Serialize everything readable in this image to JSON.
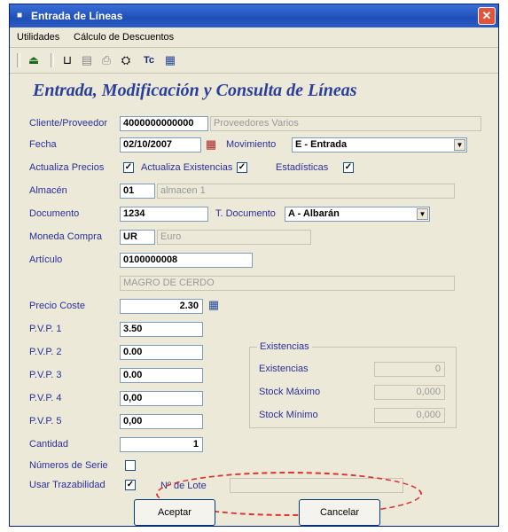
{
  "window": {
    "title": "Entrada de Líneas",
    "title_icon": "app-icon",
    "close_label": "✕"
  },
  "menu": [
    {
      "label": "Utilidades"
    },
    {
      "label": "Cálculo de Descuentos"
    }
  ],
  "toolbar": {
    "icons": [
      "exit-icon",
      "new-icon",
      "delete-icon",
      "print-icon",
      "search-icon",
      "text-icon",
      "calculator-icon"
    ],
    "glyphs": [
      "⏏",
      "⊔",
      "▤",
      "⎙",
      "⛭",
      "Tc",
      "▦"
    ]
  },
  "heading": "Entrada, Modificación y Consulta de Líneas",
  "form": {
    "cliente_label": "Cliente/Proveedor",
    "cliente_code": "4000000000000",
    "cliente_name": "Proveedores Varios",
    "fecha_label": "Fecha",
    "fecha_value": "02/10/2007",
    "movimiento_label": "Movimiento",
    "movimiento_value": "E - Entrada",
    "actualiza_precios_label": "Actualiza Precios",
    "actualiza_existencias_label": "Actualiza Existencias",
    "estadisticas_label": "Estadísticas",
    "check_mark": "✓",
    "almacen_label": "Almacén",
    "almacen_code": "01",
    "almacen_name": "almacen 1",
    "documento_label": "Documento",
    "documento_value": "1234",
    "tdocumento_label": "T. Documento",
    "tdocumento_value": "A - Albarán",
    "moneda_label": "Moneda Compra",
    "moneda_code": "UR",
    "moneda_name": "Euro",
    "articulo_label": "Artículo",
    "articulo_code": "0100000008",
    "articulo_desc": "MAGRO DE CERDO",
    "precio_label": "Precio Coste",
    "precio_value": "2.30",
    "pvp1_label": "P.V.P. 1",
    "pvp1_value": "3.50",
    "pvp2_label": "P.V.P. 2",
    "pvp2_value": "0.00",
    "pvp3_label": "P.V.P. 3",
    "pvp3_value": "0.00",
    "pvp4_label": "P.V.P. 4",
    "pvp4_value": "0,00",
    "pvp5_label": "P.V.P. 5",
    "pvp5_value": "0,00",
    "cantidad_label": "Cantidad",
    "cantidad_value": "1",
    "numeros_serie_label": "Números de Serie",
    "usar_trazabilidad_label": "Usar Trazabilidad",
    "lote_label": "Nº de Lote"
  },
  "existencias": {
    "title": "Existencias",
    "existencias_label": "Existencias",
    "existencias_value": "0",
    "stock_maximo_label": "Stock Máximo",
    "stock_maximo_value": "0,000",
    "stock_minimo_label": "Stock Mínimo",
    "stock_minimo_value": "0,000"
  },
  "buttons": {
    "aceptar": "Aceptar",
    "cancelar": "Cancelar"
  },
  "colors": {
    "title_bar": "#2a5cc4",
    "heading": "#2a3f9a",
    "label": "#2a2f9a",
    "highlight_ellipse": "#e03030"
  }
}
